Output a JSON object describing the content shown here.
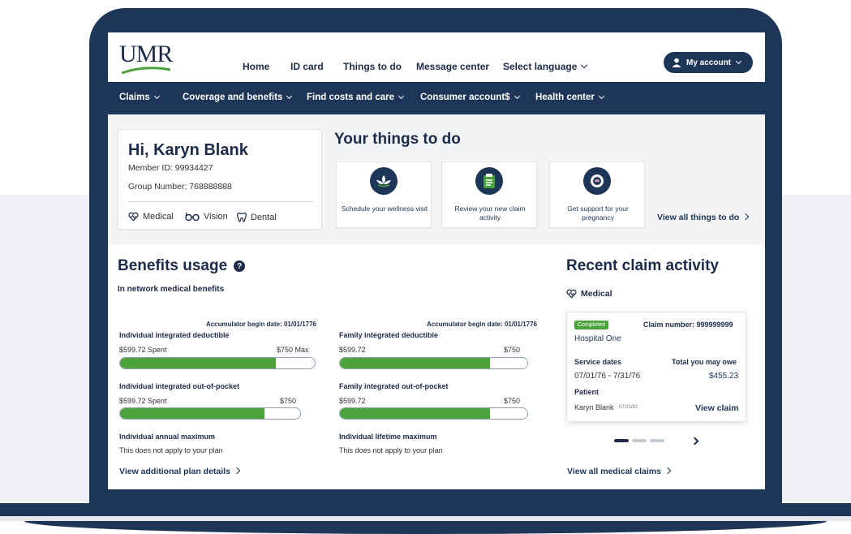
{
  "colors": {
    "navy": "#1d3557",
    "green": "#4da33b",
    "accent_text": "#1d2b4a"
  },
  "header": {
    "logo": "UMR",
    "nav": [
      "Home",
      "ID card",
      "Things to do",
      "Message center",
      "Select language"
    ],
    "account_label": "My account"
  },
  "mainnav": [
    "Claims",
    "Coverage and benefits",
    "Find costs and care",
    "Consumer account$",
    "Health center"
  ],
  "member": {
    "greeting": "Hi, Karyn Blank",
    "member_id": "Member ID: 99934427",
    "group_number": "Group Number:  768888888",
    "coverage": [
      "Medical",
      "Vision",
      "Dental"
    ]
  },
  "things": {
    "title": "Your things to do",
    "cards": [
      {
        "label": "Schedule your wellness visit",
        "icon": "wellness-lotus-icon"
      },
      {
        "label": "Review your new claim activity",
        "icon": "clipboard-icon"
      },
      {
        "label": "Get support for your pregnancy",
        "icon": "pregnancy-icon"
      }
    ],
    "view_all": "View all things to do"
  },
  "benefits": {
    "title": "Benefits usage",
    "subtitle": "In network medical benefits",
    "accumulator_label": "Accumulator begin date: 01/01/1776",
    "items": [
      {
        "label": "Individual integrated deductible",
        "spent": "$599.72 Spent",
        "max": "$750 Max",
        "progress": 0.8
      },
      {
        "label": "Family integrated deductible",
        "spent": "$599.72",
        "max": "$750",
        "progress": 0.8
      },
      {
        "label": "Individual integrated out-of-pocket",
        "spent": "$599.72 Spent",
        "max": "$750",
        "progress": 0.8
      },
      {
        "label": "Family integrated out-of-pocket",
        "spent": "$599.72",
        "max": "$750",
        "progress": 0.8
      },
      {
        "label": "Individual annual maximum",
        "note": "This does not apply to your plan"
      },
      {
        "label": "Individual lifetime maximum",
        "note": "This does not apply to your plan"
      }
    ],
    "link": "View additional plan details"
  },
  "claims": {
    "title": "Recent claim activity",
    "category": "Medical",
    "card": {
      "status": "Completed",
      "claim_number": "Claim number:  999999999",
      "provider": "Hospital One",
      "service_dates_label": "Service dates",
      "service_dates": "07/01/76 - 7/31/76",
      "owe_label": "Total you may owe",
      "owe_value": "$455.23",
      "patient_label": "Patient",
      "patient_name": "Karyn Blank",
      "patient_dob": "07/21/02",
      "view_claim": "View claim"
    },
    "link": "View all medical claims"
  }
}
